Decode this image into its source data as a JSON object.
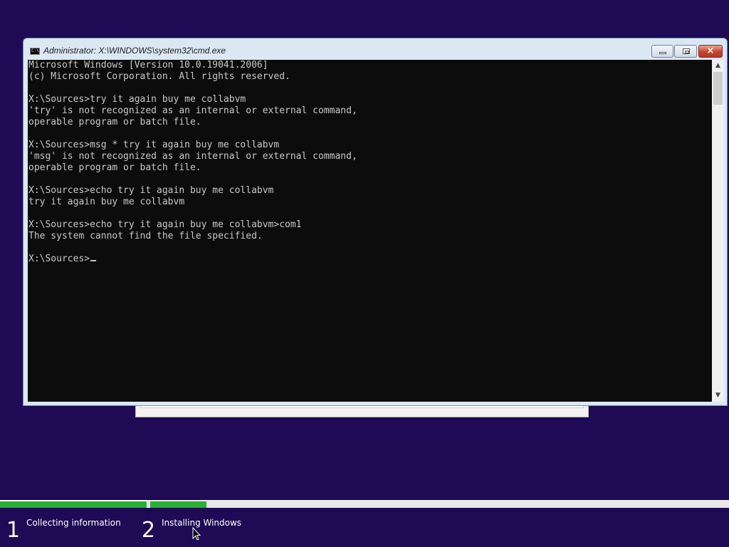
{
  "window": {
    "title": "Administrator: X:\\WINDOWS\\system32\\cmd.exe",
    "icon_text": "C:\\",
    "buttons": {
      "minimize": "minimize",
      "maximize": "restore",
      "close": "×"
    }
  },
  "console": {
    "lines": [
      "Microsoft Windows [Version 10.0.19041.2006]",
      "(c) Microsoft Corporation. All rights reserved.",
      "",
      "X:\\Sources>try it again buy me collabvm",
      "'try' is not recognized as an internal or external command,",
      "operable program or batch file.",
      "",
      "X:\\Sources>msg * try it again buy me collabvm",
      "'msg' is not recognized as an internal or external command,",
      "operable program or batch file.",
      "",
      "X:\\Sources>echo try it again buy me collabvm",
      "try it again buy me collabvm",
      "",
      "X:\\Sources>echo try it again buy me collabvm>com1",
      "The system cannot find the file specified.",
      "",
      "X:\\Sources>"
    ]
  },
  "setup": {
    "steps": [
      {
        "number": "1",
        "label": "Collecting information",
        "progress": 1.0
      },
      {
        "number": "2",
        "label": "Installing Windows",
        "progress": 0.1
      }
    ]
  },
  "colors": {
    "background": "#1e0a55",
    "progress_fill": "#27b034",
    "console_bg": "#0c0c0c",
    "console_fg": "#c8c8c8"
  }
}
